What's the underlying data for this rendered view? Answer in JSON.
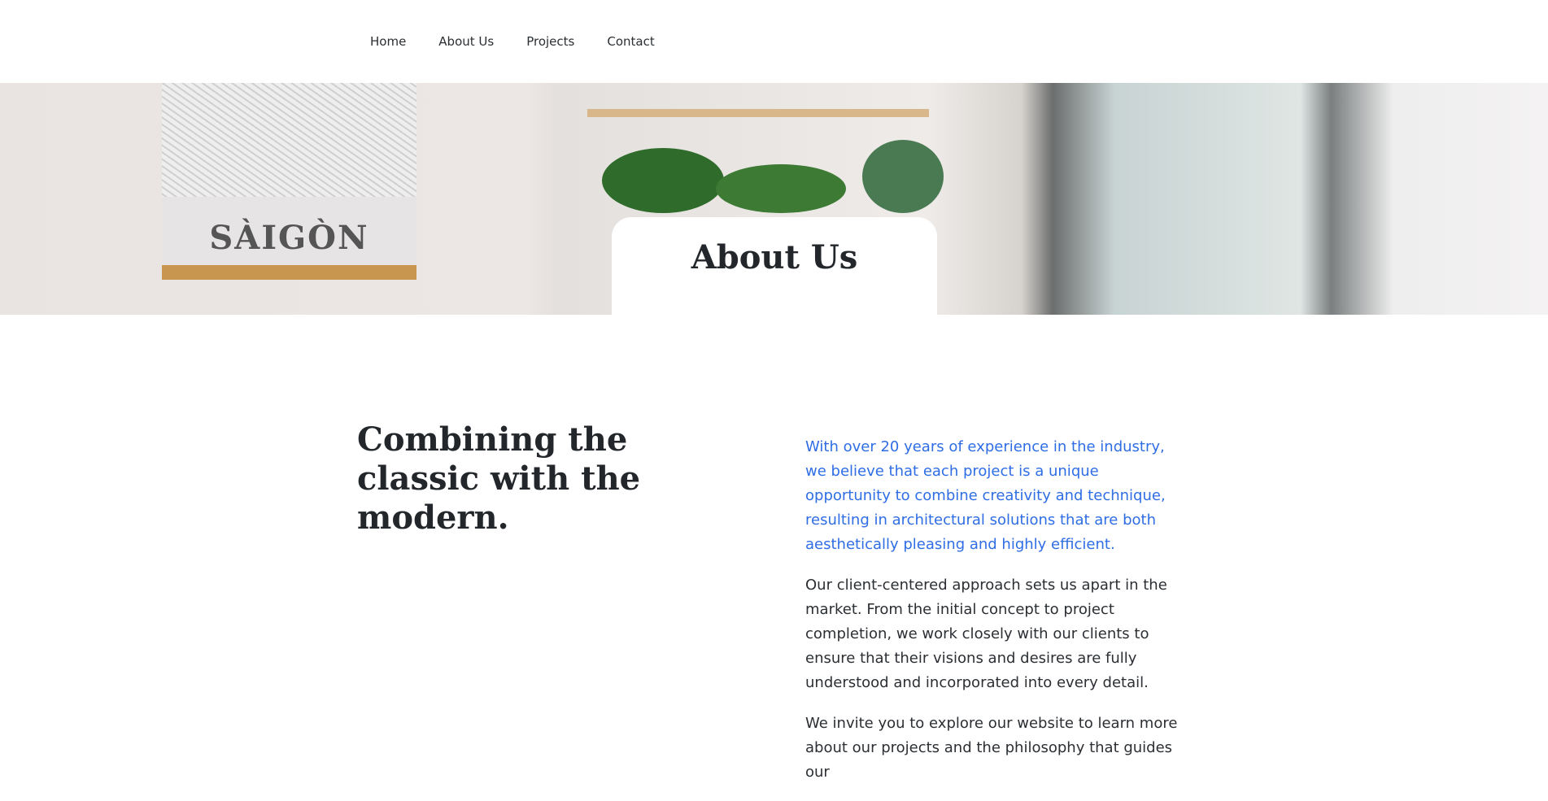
{
  "nav": {
    "items": [
      "Home",
      "About Us",
      "Projects",
      "Contact"
    ]
  },
  "hero": {
    "title": "About Us",
    "poster_text": "SÀIGÒN"
  },
  "main": {
    "heading": "Combining the classic with the modern.",
    "paragraphs": [
      "With over 20 years of experience in the industry, we believe that each project is a unique opportunity to combine creativity and technique, resulting in architectural solutions that are both aesthetically pleasing and highly efficient.",
      "Our client-centered approach sets us apart in the market. From the initial concept to project completion, we work closely with our clients to ensure that their visions and desires are fully understood and incorporated into every detail.",
      "We invite you to explore our website to learn more about our projects and the philosophy that guides our"
    ]
  },
  "colors": {
    "accent": "#2f6de5",
    "text": "#2b2f33"
  }
}
